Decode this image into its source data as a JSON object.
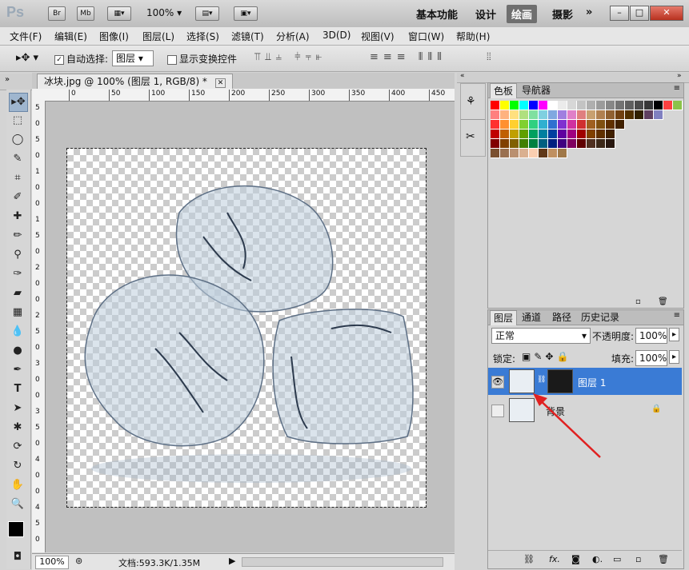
{
  "appbar": {
    "logo": "Ps",
    "br_label": "Br",
    "mb_label": "Mb",
    "zoom": "100%",
    "workspaces": [
      "基本功能",
      "设计",
      "绘画",
      "摄影"
    ],
    "more": "»"
  },
  "menu": [
    "文件(F)",
    "编辑(E)",
    "图像(I)",
    "图层(L)",
    "选择(S)",
    "滤镜(T)",
    "分析(A)",
    "3D(D)",
    "视图(V)",
    "窗口(W)",
    "帮助(H)"
  ],
  "options": {
    "auto_select_label": "自动选择:",
    "auto_select_value": "图层",
    "show_transform_label": "显示变换控件"
  },
  "document": {
    "tab_title": "冰块.jpg @ 100% (图层 1, RGB/8) *",
    "ruler_top_labels": [
      "0",
      "50",
      "100",
      "150",
      "200",
      "250",
      "300",
      "350",
      "400",
      "450"
    ],
    "ruler_left_labels": [
      "5",
      "0",
      "5",
      "0",
      "1",
      "0",
      "0",
      "1",
      "5",
      "0",
      "2",
      "0",
      "0",
      "2",
      "5",
      "0",
      "3",
      "0",
      "0",
      "3",
      "5",
      "0",
      "4",
      "0",
      "0",
      "4",
      "5",
      "0"
    ],
    "zoom": "100%",
    "doc_info": "文档:593.3K/1.35M"
  },
  "swatches_panel": {
    "tabs": [
      "色板",
      "导航器"
    ]
  },
  "layers_panel": {
    "tabs": [
      "图层",
      "通道",
      "路径",
      "历史记录"
    ],
    "blend_mode": "正常",
    "opacity_label": "不透明度:",
    "opacity_value": "100%",
    "lock_label": "锁定:",
    "fill_label": "填充:",
    "fill_value": "100%",
    "layers": [
      {
        "name": "图层 1",
        "selected": true,
        "visible": true
      },
      {
        "name": "背景",
        "selected": false,
        "visible": false,
        "locked": true
      }
    ]
  },
  "colors": {
    "selection": "#3a7bd5",
    "active_workspace": "#6f6f6f"
  }
}
